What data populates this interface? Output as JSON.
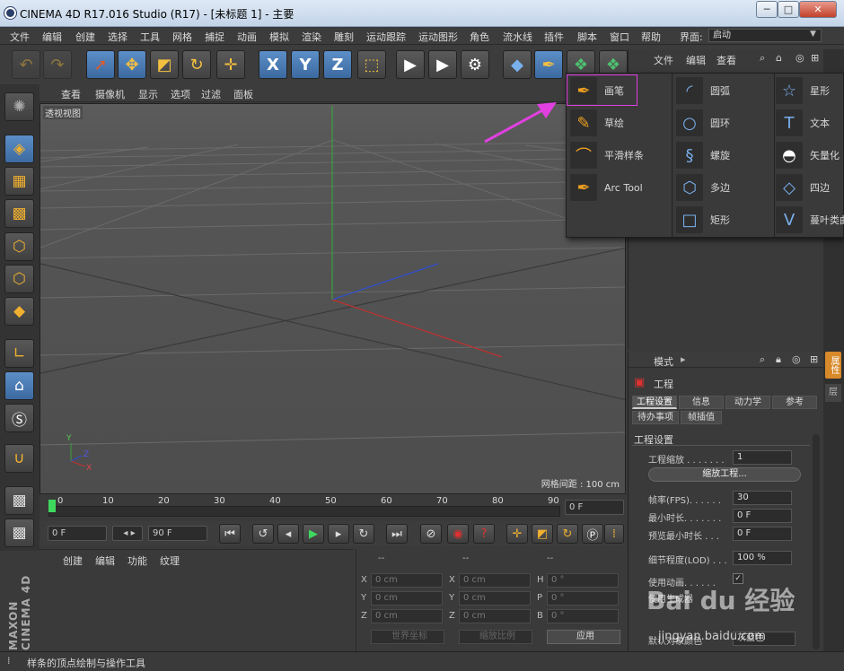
{
  "window": {
    "title": "CINEMA 4D R17.016 Studio (R17) - [未标题 1] - 主要",
    "min": "─",
    "max": "□",
    "close": "✕"
  },
  "menu": {
    "items": [
      "文件",
      "编辑",
      "创建",
      "选择",
      "工具",
      "网格",
      "捕捉",
      "动画",
      "模拟",
      "渲染",
      "雕刻",
      "运动跟踪",
      "运动图形",
      "角色",
      "流水线",
      "插件",
      "脚本",
      "窗口",
      "帮助"
    ],
    "layout_label": "界面:",
    "layout_value": "启动"
  },
  "toolbar": {
    "icons": [
      "undo-icon",
      "redo-icon",
      "live-select-icon",
      "move-icon",
      "scale-icon",
      "rotate-icon",
      "move-plus-icon",
      "x-axis-icon",
      "y-axis-icon",
      "z-axis-icon",
      "world-coord-icon",
      "render-view-icon",
      "render-picture-icon",
      "render-settings-icon",
      "cube-icon",
      "pen-icon",
      "nurbs-icon",
      "array-icon"
    ],
    "x": "X",
    "y": "Y",
    "z": "Z"
  },
  "viewport": {
    "menu": [
      "查看",
      "摄像机",
      "显示",
      "选项",
      "过滤",
      "面板"
    ],
    "label": "透视视图",
    "grid_info": "网格间距 : 100 cm",
    "axis": {
      "x": "X",
      "y": "Y",
      "z": "Z"
    }
  },
  "timeline": {
    "ticks": [
      "0",
      "10",
      "20",
      "30",
      "40",
      "50",
      "60",
      "70",
      "80",
      "90"
    ],
    "current_frame": "0 F",
    "start": "0 F",
    "end": "90 F"
  },
  "materials": {
    "menu": [
      "创建",
      "编辑",
      "功能",
      "纹理"
    ]
  },
  "coords": {
    "header": "--",
    "rows": [
      {
        "a": "X",
        "av": "0 cm",
        "b": "X",
        "bv": "0 cm",
        "c": "H",
        "cv": "0 °"
      },
      {
        "a": "Y",
        "av": "0 cm",
        "b": "Y",
        "bv": "0 cm",
        "c": "P",
        "cv": "0 °"
      },
      {
        "a": "Z",
        "av": "0 cm",
        "b": "Z",
        "bv": "0 cm",
        "c": "B",
        "cv": "0 °"
      }
    ],
    "world": "世界坐标",
    "scale": "缩放比例",
    "apply": "应用"
  },
  "object_panel": {
    "menu": [
      "文件",
      "编辑",
      "查看"
    ]
  },
  "attributes": {
    "mode": "模式",
    "title": "工程",
    "tabs": [
      "工程设置",
      "信息",
      "动力学",
      "参考",
      "待办事项",
      "帧插值"
    ],
    "section": "工程设置",
    "scale_label": "工程缩放 . . . . . . .",
    "scale_value": "1",
    "scale_button": "缩放工程...",
    "fps_label": "帧率(FPS). . . . . .",
    "fps_value": "30",
    "min_label": "最小时长. . . . . . .",
    "min_value": "0 F",
    "preview_label": "预览最小时长 . . .",
    "preview_value": "0 F",
    "lod_label": "细节程度(LOD) . . .",
    "lod_value": "100 %",
    "anim_label": "使用动画. . . . . .",
    "gen_label": "使用生成器",
    "default_label": "默认对象颜色",
    "default_value": "灰蓝色"
  },
  "popup": {
    "col1": [
      "画笔",
      "草绘",
      "平滑样条",
      "Arc Tool"
    ],
    "col2": [
      "圆弧",
      "圆环",
      "螺旋",
      "多边",
      "矩形"
    ],
    "col3": [
      "星形",
      "文本",
      "矢量化",
      "四边",
      "蔓叶类曲线"
    ]
  },
  "status": "样条的顶点绘制与操作工具",
  "right_tab": "属性",
  "right_tab2": "层",
  "watermark": "Bai du 经验",
  "watermark_url": "jingyan.baidu.com",
  "brand": "MAXON CINEMA 4D"
}
